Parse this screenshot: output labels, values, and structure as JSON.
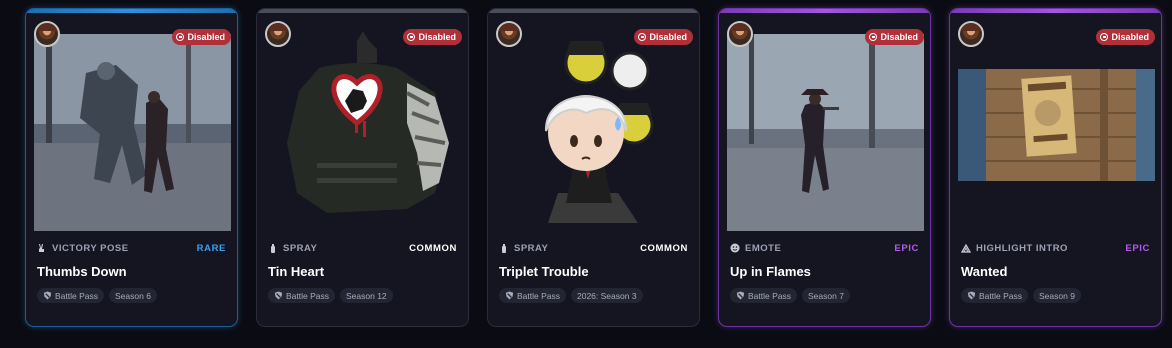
{
  "cards": [
    {
      "type_label": "VICTORY POSE",
      "type_icon": "victory-hand-icon",
      "rarity": "RARE",
      "rarity_color": "#3aa0f0",
      "name": "Thumbs Down",
      "status": "Disabled",
      "tags": [
        "Battle Pass",
        "Season 6"
      ]
    },
    {
      "type_label": "SPRAY",
      "type_icon": "spray-can-icon",
      "rarity": "COMMON",
      "rarity_color": "#ffffff",
      "name": "Tin Heart",
      "status": "Disabled",
      "tags": [
        "Battle Pass",
        "Season 12"
      ]
    },
    {
      "type_label": "SPRAY",
      "type_icon": "spray-can-icon",
      "rarity": "COMMON",
      "rarity_color": "#ffffff",
      "name": "Triplet Trouble",
      "status": "Disabled",
      "tags": [
        "Battle Pass",
        "2026: Season 3"
      ]
    },
    {
      "type_label": "EMOTE",
      "type_icon": "emote-face-icon",
      "rarity": "EPIC",
      "rarity_color": "#b25be8",
      "name": "Up in Flames",
      "status": "Disabled",
      "tags": [
        "Battle Pass",
        "Season 7"
      ]
    },
    {
      "type_label": "HIGHLIGHT INTRO",
      "type_icon": "highlight-intro-icon",
      "rarity": "EPIC",
      "rarity_color": "#b25be8",
      "name": "Wanted",
      "status": "Disabled",
      "tags": [
        "Battle Pass",
        "Season 9"
      ]
    }
  ]
}
